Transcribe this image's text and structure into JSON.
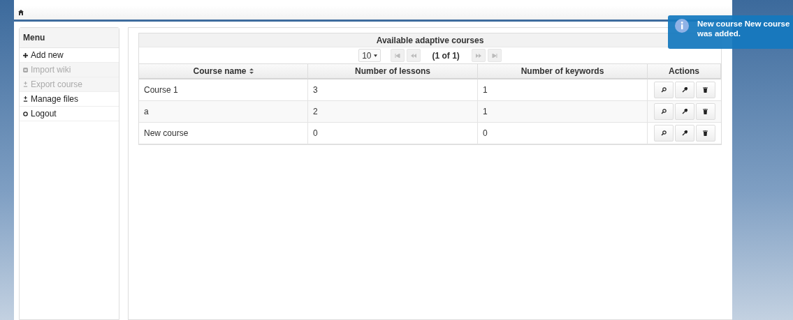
{
  "menu": {
    "title": "Menu",
    "items": [
      {
        "label": "Add new",
        "disabled": false
      },
      {
        "label": "Import wiki",
        "disabled": true
      },
      {
        "label": "Export course",
        "disabled": true
      },
      {
        "label": "Manage files",
        "disabled": false
      },
      {
        "label": "Logout",
        "disabled": false
      }
    ]
  },
  "table": {
    "title": "Available adaptive courses",
    "page_size": "10",
    "page_info": "(1 of 1)",
    "columns": [
      {
        "label": "Course name",
        "sortable": true
      },
      {
        "label": "Number of lessons",
        "sortable": false
      },
      {
        "label": "Number of keywords",
        "sortable": false
      },
      {
        "label": "Actions",
        "sortable": false
      }
    ],
    "rows": [
      [
        "Course 1",
        "3",
        "1"
      ],
      [
        "a",
        "2",
        "1"
      ],
      [
        "New course",
        "0",
        "0"
      ]
    ]
  },
  "toast": {
    "message": "New course New course was added."
  }
}
